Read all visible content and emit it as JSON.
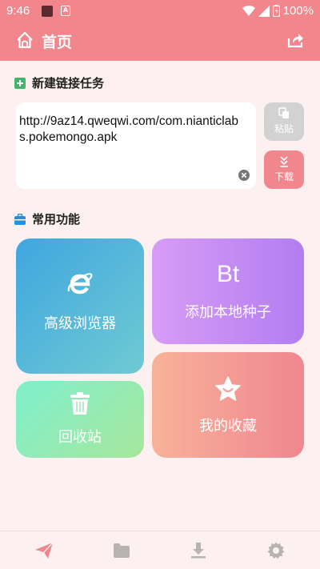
{
  "status_bar": {
    "time": "9:46",
    "battery": "100%",
    "notif_letter": "A"
  },
  "header": {
    "title": "首页"
  },
  "new_task": {
    "heading": "新建链接任务",
    "url_value": "http://9az14.qweqwi.com/com.nianticlabs.pokemongo.apk",
    "paste_label": "粘贴",
    "download_label": "下载"
  },
  "features": {
    "heading": "常用功能",
    "browser_label": "高级浏览器",
    "seed_icon_text": "Bt",
    "seed_label": "添加本地种子",
    "recycle_label": "回收站",
    "favorites_label": "我的收藏"
  },
  "colors": {
    "accent": "#f2868d",
    "background": "#fdf0f0",
    "nav_active": "#f2868d",
    "nav_inactive": "#b8b3b3"
  },
  "bottom_nav": {
    "items": [
      "send-icon",
      "folder-icon",
      "download-icon",
      "settings-icon"
    ],
    "active": 0
  }
}
